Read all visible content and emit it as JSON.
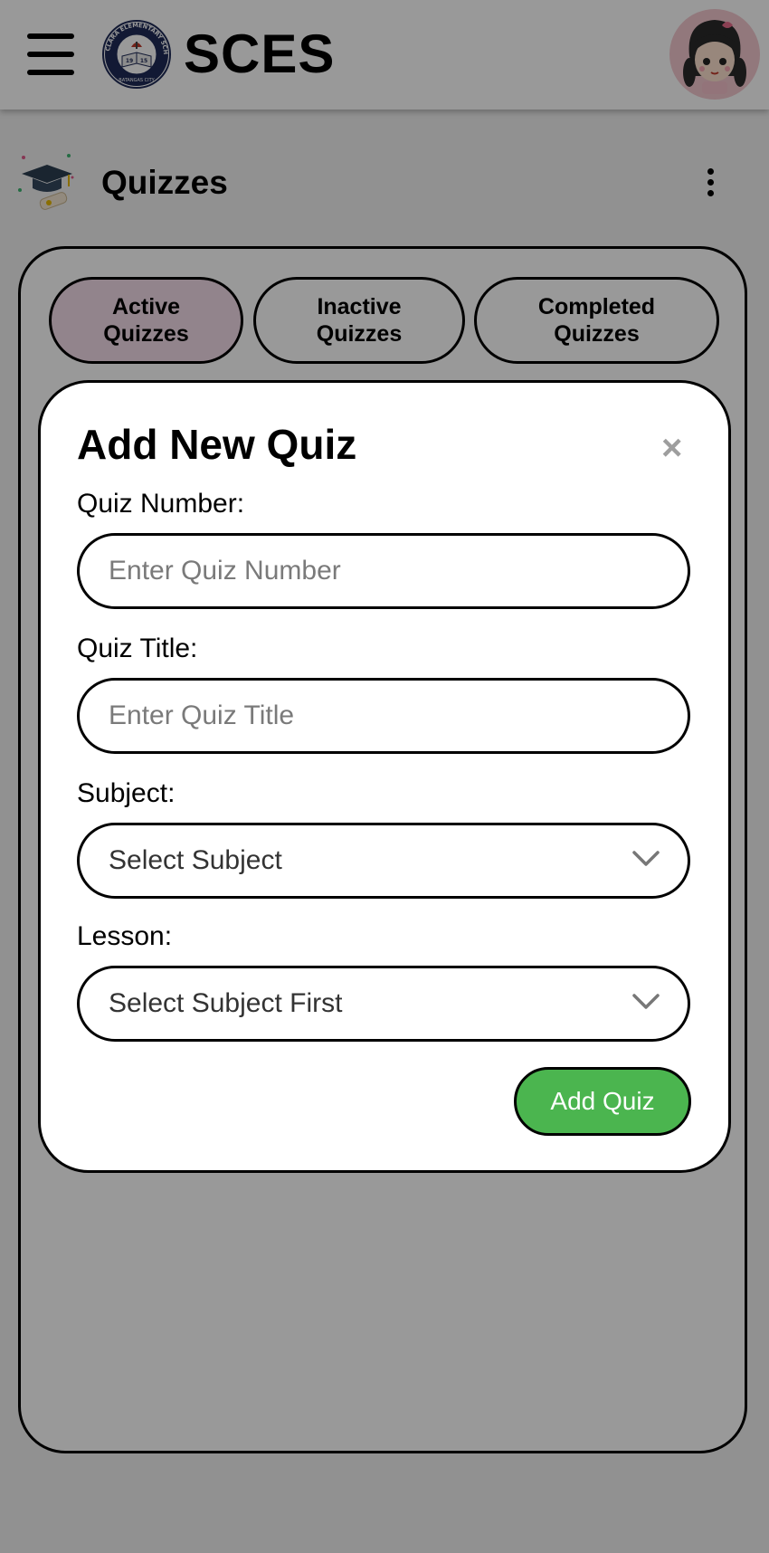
{
  "header": {
    "brand": "SCES",
    "logo": {
      "ring_text": "STA. CLARA ELEMENTARY SCHOOL",
      "bottom_text": "BATANGAS CITY",
      "year_left": "19",
      "year_right": "15"
    }
  },
  "page": {
    "title": "Quizzes"
  },
  "tabs": [
    {
      "line1": "Active",
      "line2": "Quizzes",
      "active": true
    },
    {
      "line1": "Inactive",
      "line2": "Quizzes",
      "active": false
    },
    {
      "line1": "Completed",
      "line2": "Quizzes",
      "active": false
    }
  ],
  "modal": {
    "title": "Add New Quiz",
    "close_symbol": "×",
    "quiz_number": {
      "label": "Quiz Number:",
      "placeholder": "Enter Quiz Number",
      "value": ""
    },
    "quiz_title": {
      "label": "Quiz Title:",
      "placeholder": "Enter Quiz Title",
      "value": ""
    },
    "subject": {
      "label": "Subject:",
      "selected": "Select Subject"
    },
    "lesson": {
      "label": "Lesson:",
      "selected": "Select Subject First"
    },
    "submit_label": "Add Quiz"
  },
  "colors": {
    "active_tab": "#f4dce9",
    "submit_button": "#4bb54f",
    "overlay": "rgba(0,0,0,0.40)",
    "avatar_bg": "#f4c9cf"
  }
}
